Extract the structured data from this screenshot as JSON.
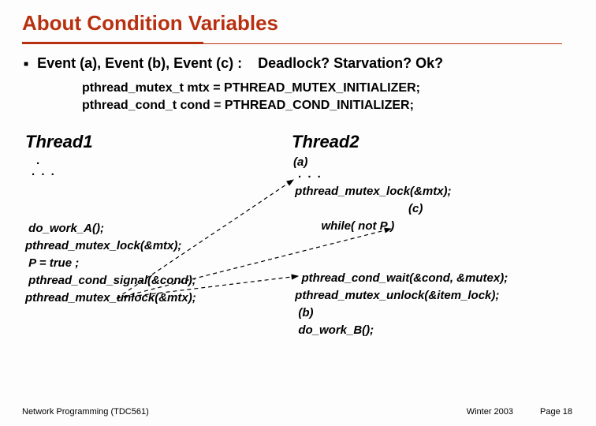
{
  "title": "About Condition Variables",
  "bullet": {
    "left": "Event (a), Event (b), Event (c) :",
    "right": "Deadlock? Starvation? Ok?"
  },
  "init": {
    "l1": "pthread_mutex_t mtx = PTHREAD_MUTEX_INITIALIZER;",
    "l2": "pthread_cond_t cond = PTHREAD_COND_INITIALIZER;"
  },
  "thread1": {
    "title": "Thread1",
    "dot": ".",
    "dots": ". . .",
    "l1": " do_work_A();",
    "l2": "pthread_mutex_lock(&mtx);",
    "l3": " P = true ;",
    "l4": " pthread_cond_signal(&cond);",
    "l5": "pthread_mutex_unlock(&mtx);"
  },
  "thread2": {
    "title": "Thread2",
    "label_a": "(a)",
    "dots": ". . .",
    "l1": " pthread_mutex_lock(&mtx);",
    "l2a": " while( not P )",
    "label_c": "(c)",
    "l3": "   pthread_cond_wait(&cond, &mutex);",
    "l4": " pthread_mutex_unlock(&item_lock);",
    "label_b": "  (b)",
    "l5": "  do_work_B();"
  },
  "footer": {
    "left": "Network Programming (TDC561)",
    "center": "Winter  2003",
    "right": "Page 18"
  }
}
